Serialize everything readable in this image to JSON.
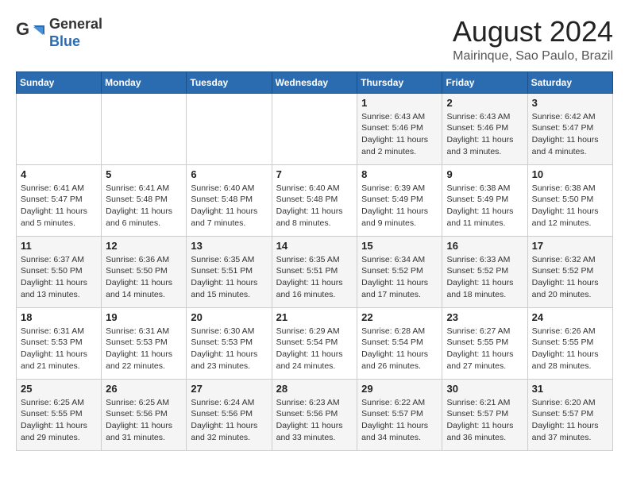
{
  "header": {
    "logo_text_general": "General",
    "logo_text_blue": "Blue",
    "title": "August 2024",
    "subtitle": "Mairinque, Sao Paulo, Brazil"
  },
  "calendar": {
    "weekdays": [
      "Sunday",
      "Monday",
      "Tuesday",
      "Wednesday",
      "Thursday",
      "Friday",
      "Saturday"
    ],
    "weeks": [
      [
        {
          "day": "",
          "info": ""
        },
        {
          "day": "",
          "info": ""
        },
        {
          "day": "",
          "info": ""
        },
        {
          "day": "",
          "info": ""
        },
        {
          "day": "1",
          "info": "Sunrise: 6:43 AM\nSunset: 5:46 PM\nDaylight: 11 hours\nand 2 minutes."
        },
        {
          "day": "2",
          "info": "Sunrise: 6:43 AM\nSunset: 5:46 PM\nDaylight: 11 hours\nand 3 minutes."
        },
        {
          "day": "3",
          "info": "Sunrise: 6:42 AM\nSunset: 5:47 PM\nDaylight: 11 hours\nand 4 minutes."
        }
      ],
      [
        {
          "day": "4",
          "info": "Sunrise: 6:41 AM\nSunset: 5:47 PM\nDaylight: 11 hours\nand 5 minutes."
        },
        {
          "day": "5",
          "info": "Sunrise: 6:41 AM\nSunset: 5:48 PM\nDaylight: 11 hours\nand 6 minutes."
        },
        {
          "day": "6",
          "info": "Sunrise: 6:40 AM\nSunset: 5:48 PM\nDaylight: 11 hours\nand 7 minutes."
        },
        {
          "day": "7",
          "info": "Sunrise: 6:40 AM\nSunset: 5:48 PM\nDaylight: 11 hours\nand 8 minutes."
        },
        {
          "day": "8",
          "info": "Sunrise: 6:39 AM\nSunset: 5:49 PM\nDaylight: 11 hours\nand 9 minutes."
        },
        {
          "day": "9",
          "info": "Sunrise: 6:38 AM\nSunset: 5:49 PM\nDaylight: 11 hours\nand 11 minutes."
        },
        {
          "day": "10",
          "info": "Sunrise: 6:38 AM\nSunset: 5:50 PM\nDaylight: 11 hours\nand 12 minutes."
        }
      ],
      [
        {
          "day": "11",
          "info": "Sunrise: 6:37 AM\nSunset: 5:50 PM\nDaylight: 11 hours\nand 13 minutes."
        },
        {
          "day": "12",
          "info": "Sunrise: 6:36 AM\nSunset: 5:50 PM\nDaylight: 11 hours\nand 14 minutes."
        },
        {
          "day": "13",
          "info": "Sunrise: 6:35 AM\nSunset: 5:51 PM\nDaylight: 11 hours\nand 15 minutes."
        },
        {
          "day": "14",
          "info": "Sunrise: 6:35 AM\nSunset: 5:51 PM\nDaylight: 11 hours\nand 16 minutes."
        },
        {
          "day": "15",
          "info": "Sunrise: 6:34 AM\nSunset: 5:52 PM\nDaylight: 11 hours\nand 17 minutes."
        },
        {
          "day": "16",
          "info": "Sunrise: 6:33 AM\nSunset: 5:52 PM\nDaylight: 11 hours\nand 18 minutes."
        },
        {
          "day": "17",
          "info": "Sunrise: 6:32 AM\nSunset: 5:52 PM\nDaylight: 11 hours\nand 20 minutes."
        }
      ],
      [
        {
          "day": "18",
          "info": "Sunrise: 6:31 AM\nSunset: 5:53 PM\nDaylight: 11 hours\nand 21 minutes."
        },
        {
          "day": "19",
          "info": "Sunrise: 6:31 AM\nSunset: 5:53 PM\nDaylight: 11 hours\nand 22 minutes."
        },
        {
          "day": "20",
          "info": "Sunrise: 6:30 AM\nSunset: 5:53 PM\nDaylight: 11 hours\nand 23 minutes."
        },
        {
          "day": "21",
          "info": "Sunrise: 6:29 AM\nSunset: 5:54 PM\nDaylight: 11 hours\nand 24 minutes."
        },
        {
          "day": "22",
          "info": "Sunrise: 6:28 AM\nSunset: 5:54 PM\nDaylight: 11 hours\nand 26 minutes."
        },
        {
          "day": "23",
          "info": "Sunrise: 6:27 AM\nSunset: 5:55 PM\nDaylight: 11 hours\nand 27 minutes."
        },
        {
          "day": "24",
          "info": "Sunrise: 6:26 AM\nSunset: 5:55 PM\nDaylight: 11 hours\nand 28 minutes."
        }
      ],
      [
        {
          "day": "25",
          "info": "Sunrise: 6:25 AM\nSunset: 5:55 PM\nDaylight: 11 hours\nand 29 minutes."
        },
        {
          "day": "26",
          "info": "Sunrise: 6:25 AM\nSunset: 5:56 PM\nDaylight: 11 hours\nand 31 minutes."
        },
        {
          "day": "27",
          "info": "Sunrise: 6:24 AM\nSunset: 5:56 PM\nDaylight: 11 hours\nand 32 minutes."
        },
        {
          "day": "28",
          "info": "Sunrise: 6:23 AM\nSunset: 5:56 PM\nDaylight: 11 hours\nand 33 minutes."
        },
        {
          "day": "29",
          "info": "Sunrise: 6:22 AM\nSunset: 5:57 PM\nDaylight: 11 hours\nand 34 minutes."
        },
        {
          "day": "30",
          "info": "Sunrise: 6:21 AM\nSunset: 5:57 PM\nDaylight: 11 hours\nand 36 minutes."
        },
        {
          "day": "31",
          "info": "Sunrise: 6:20 AM\nSunset: 5:57 PM\nDaylight: 11 hours\nand 37 minutes."
        }
      ]
    ]
  }
}
